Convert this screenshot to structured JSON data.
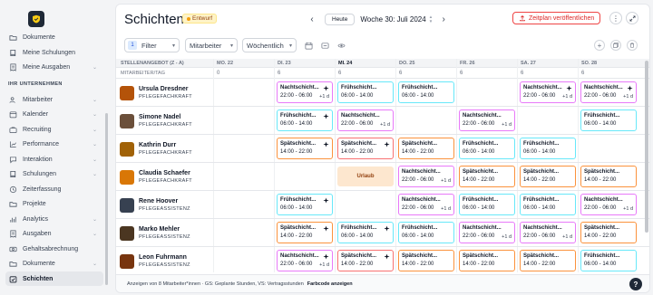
{
  "sidebar": {
    "items_top": [
      {
        "label": "Dokumente",
        "icon": "folder-icon",
        "chev": false
      },
      {
        "label": "Meine Schulungen",
        "icon": "book-icon",
        "chev": false
      },
      {
        "label": "Meine Ausgaben",
        "icon": "receipt-icon",
        "chev": true
      }
    ],
    "section": "IHR UNTERNEHMEN",
    "items": [
      {
        "label": "Mitarbeiter",
        "icon": "users-icon",
        "chev": true
      },
      {
        "label": "Kalender",
        "icon": "calendar-icon",
        "chev": true
      },
      {
        "label": "Recruiting",
        "icon": "briefcase-icon",
        "chev": true
      },
      {
        "label": "Performance",
        "icon": "chart-icon",
        "chev": true
      },
      {
        "label": "Interaktion",
        "icon": "chat-icon",
        "chev": true
      },
      {
        "label": "Schulungen",
        "icon": "book-icon",
        "chev": true
      },
      {
        "label": "Zeiterfassung",
        "icon": "clock-icon",
        "chev": false
      },
      {
        "label": "Projekte",
        "icon": "folder-icon",
        "chev": false
      },
      {
        "label": "Analytics",
        "icon": "analytics-icon",
        "chev": true
      },
      {
        "label": "Ausgaben",
        "icon": "receipt-icon",
        "chev": true
      },
      {
        "label": "Gehaltsabrechnung",
        "icon": "payroll-icon",
        "chev": false
      },
      {
        "label": "Dokumente",
        "icon": "folder-icon",
        "chev": true
      },
      {
        "label": "Schichten",
        "icon": "shifts-icon",
        "chev": false,
        "active": true
      }
    ]
  },
  "header": {
    "title": "Schichten",
    "badge": "Entwurf",
    "today_btn": "Heute",
    "week": "Woche 30: Juli 2024",
    "publish": "Zeitplan veröffentlichen"
  },
  "toolbar": {
    "filter_count": "1",
    "filter": "Filter",
    "employee_dd": "Mitarbeiter",
    "period_dd": "Wöchentlich"
  },
  "grid": {
    "sort_label": "STELLENANGEBOT (Z - A)",
    "sub_label": "MITARBEITER/TAG",
    "days": [
      {
        "label": "MO. 22",
        "count": "0",
        "today": false
      },
      {
        "label": "DI. 23",
        "count": "6",
        "today": false
      },
      {
        "label": "MI. 24",
        "count": "6",
        "today": true
      },
      {
        "label": "DO. 25",
        "count": "6",
        "today": false
      },
      {
        "label": "FR. 26",
        "count": "6",
        "today": false
      },
      {
        "label": "SA. 27",
        "count": "6",
        "today": false
      },
      {
        "label": "SO. 28",
        "count": "6",
        "today": false
      }
    ],
    "employees": [
      {
        "name": "Ursula Dresdner",
        "role": "PFLEGEFACHKRAFT",
        "avatar": "#b45309",
        "shifts": [
          null,
          {
            "name": "Nachtschicht...",
            "time": "22:00 - 06:00",
            "plus": "+1 d",
            "color": "pink",
            "spark": true
          },
          {
            "name": "Frühschicht...",
            "time": "06:00 - 14:00",
            "color": "teal"
          },
          {
            "name": "Frühschicht...",
            "time": "06:00 - 14:00",
            "color": "teal"
          },
          null,
          {
            "name": "Nachtschicht...",
            "time": "22:00 - 06:00",
            "plus": "+1 d",
            "color": "pink",
            "spark": true
          },
          {
            "name": "Nachtschicht...",
            "time": "22:00 - 06:00",
            "plus": "+1 d",
            "color": "pink",
            "spark": true
          }
        ]
      },
      {
        "name": "Simone Nadel",
        "role": "PFLEGEFACHKRAFT",
        "avatar": "#6b4f3a",
        "shifts": [
          null,
          {
            "name": "Frühschicht...",
            "time": "06:00 - 14:00",
            "color": "teal",
            "spark": true
          },
          {
            "name": "Nachtschicht...",
            "time": "22:00 - 06:00",
            "plus": "+1 d",
            "color": "pink"
          },
          null,
          {
            "name": "Nachtschicht...",
            "time": "22:00 - 06:00",
            "plus": "+1 d",
            "color": "pink"
          },
          null,
          {
            "name": "Frühschicht...",
            "time": "06:00 - 14:00",
            "color": "teal"
          }
        ]
      },
      {
        "name": "Kathrin Durr",
        "role": "PFLEGEFACHKRAFT",
        "avatar": "#a16207",
        "shifts": [
          null,
          {
            "name": "Spätschicht...",
            "time": "14:00 - 22:00",
            "color": "orange",
            "spark": true
          },
          {
            "name": "Spätschicht...",
            "time": "14:00 - 22:00",
            "color": "red",
            "spark": true
          },
          {
            "name": "Spätschicht...",
            "time": "14:00 - 22:00",
            "color": "orange"
          },
          {
            "name": "Frühschicht...",
            "time": "06:00 - 14:00",
            "color": "teal"
          },
          {
            "name": "Frühschicht...",
            "time": "06:00 - 14:00",
            "color": "teal"
          },
          null
        ]
      },
      {
        "name": "Claudia Schaefer",
        "role": "PFLEGEFACHKRAFT",
        "avatar": "#d97706",
        "shifts": [
          null,
          null,
          {
            "urlaub": "Urlaub"
          },
          {
            "name": "Nachtschicht...",
            "time": "22:00 - 06:00",
            "plus": "+1 d",
            "color": "pink"
          },
          {
            "name": "Spätschicht...",
            "time": "14:00 - 22:00",
            "color": "orange"
          },
          {
            "name": "Spätschicht...",
            "time": "14:00 - 22:00",
            "color": "orange"
          },
          {
            "name": "Spätschicht...",
            "time": "14:00 - 22:00",
            "color": "orange"
          }
        ]
      },
      {
        "name": "Rene Hoover",
        "role": "PFLEGEASSISTENZ",
        "avatar": "#374151",
        "shifts": [
          null,
          {
            "name": "Frühschicht...",
            "time": "06:00 - 14:00",
            "color": "teal",
            "spark": true
          },
          null,
          {
            "name": "Nachtschicht...",
            "time": "22:00 - 06:00",
            "plus": "+1 d",
            "color": "pink"
          },
          {
            "name": "Frühschicht...",
            "time": "06:00 - 14:00",
            "color": "teal"
          },
          {
            "name": "Frühschicht...",
            "time": "06:00 - 14:00",
            "color": "teal"
          },
          {
            "name": "Nachtschicht...",
            "time": "22:00 - 06:00",
            "plus": "+1 d",
            "color": "pink"
          }
        ]
      },
      {
        "name": "Marko Mehler",
        "role": "PFLEGEASSISTENZ",
        "avatar": "#4b3621",
        "shifts": [
          null,
          {
            "name": "Spätschicht...",
            "time": "14:00 - 22:00",
            "color": "orange",
            "spark": true
          },
          {
            "name": "Frühschicht...",
            "time": "06:00 - 14:00",
            "color": "teal",
            "spark": true
          },
          {
            "name": "Frühschicht...",
            "time": "06:00 - 14:00",
            "color": "teal"
          },
          {
            "name": "Nachtschicht...",
            "time": "22:00 - 06:00",
            "plus": "+1 d",
            "color": "pink"
          },
          {
            "name": "Nachtschicht...",
            "time": "22:00 - 06:00",
            "plus": "+1 d",
            "color": "pink"
          },
          {
            "name": "Spätschicht...",
            "time": "14:00 - 22:00",
            "color": "orange"
          }
        ]
      },
      {
        "name": "Leon Fuhrmann",
        "role": "PFLEGEASSISTENZ",
        "avatar": "#78350f",
        "shifts": [
          null,
          {
            "name": "Nachtschicht...",
            "time": "22:00 - 06:00",
            "plus": "+1 d",
            "color": "pink",
            "spark": true
          },
          {
            "name": "Spätschicht...",
            "time": "14:00 - 22:00",
            "color": "red",
            "spark": true
          },
          {
            "name": "Spätschicht...",
            "time": "14:00 - 22:00",
            "color": "orange"
          },
          {
            "name": "Spätschicht...",
            "time": "14:00 - 22:00",
            "color": "orange"
          },
          {
            "name": "Spätschicht...",
            "time": "14:00 - 22:00",
            "color": "orange"
          },
          {
            "name": "Frühschicht...",
            "time": "06:00 - 14:00",
            "color": "teal"
          }
        ]
      }
    ]
  },
  "footer": {
    "text": "Anzeigen von 8 Mitarbeiter*innen · GS: Geplante Stunden, VS: Vertragsstunden",
    "link": "Farbcode anzeigen",
    "help": "?"
  }
}
